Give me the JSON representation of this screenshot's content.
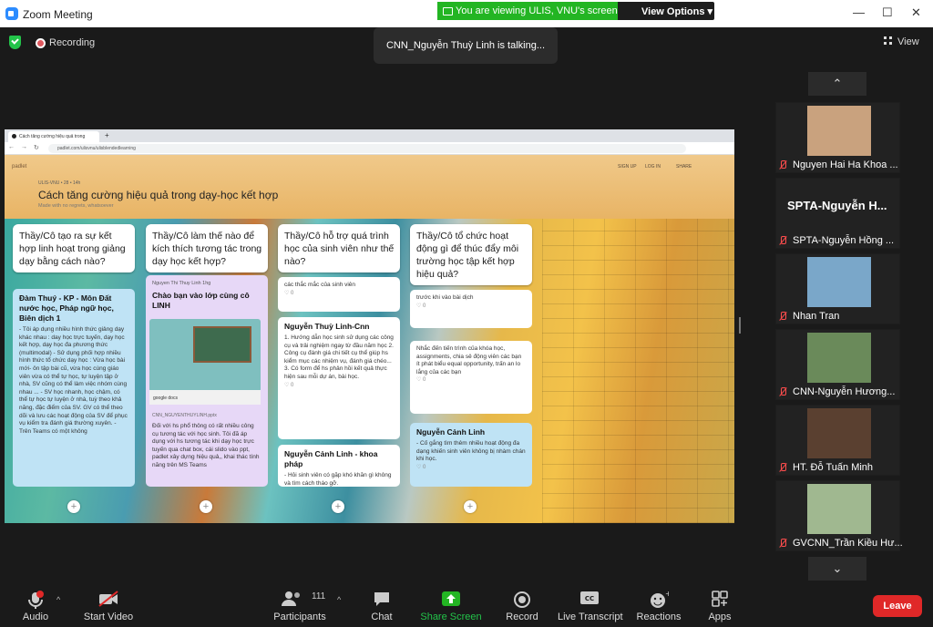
{
  "window": {
    "title": "Zoom Meeting",
    "minimize": "—",
    "maximize": "☐",
    "close": "✕"
  },
  "banner": {
    "text": "You are viewing ULIS, VNU's screen",
    "view_options": "View Options"
  },
  "recording": "Recording",
  "talking": "CNN_Nguyễn Thuỳ Linh is talking...",
  "view": "View",
  "browser": {
    "tab_title": "Cách tăng cường hiệu quả trong",
    "url": "padlet.com/ulisvnu/ulisblendedlearning"
  },
  "padlet": {
    "logo": "padlet",
    "signup": "SIGN UP",
    "login": "LOG IN",
    "share": "SHARE",
    "meta": "ULIS-VNU  •  28  •  14h",
    "title": "Cách tăng cường hiệu quả trong dạy-học kết hợp",
    "subtitle": "Made with no regrets, whatsoever",
    "columns": [
      {
        "header": "Thầy/Cô tạo ra sự kết hợp linh hoạt trong giảng dạy bằng cách nào?",
        "cards": [
          {
            "title": "Đàm Thuý - KP - Môn Đất nước học, Pháp ngữ học, Biên dịch 1",
            "body": "-     Tôi áp dụng nhiều hình thức giảng dạy khác nhau : day học trực tuyến, dạy học kết hợp, dạy học đa phương thức (multimodal) -     Sử dụng phối hợp nhiều hình thức tổ chức dạy học : Vừa học bài mới- ôn tập bài cũ, vừa học cùng giáo viên vừa có thể tự học, tự luyện tập ở nhà, SV cũng có thể làm việc nhóm cùng nhau ... -     SV học nhanh, học chậm, có thể tự học tự luyện ở nhà, tuỳ theo khả năng, đặc điểm của SV. GV có thể theo dõi và lưu các hoạt động của SV để phục vụ kiểm tra đánh giá thường xuyên. -     Trên Teams có một không"
          }
        ]
      },
      {
        "header": "Thầy/Cô làm thế nào để kích thích tương tác trong dạy học kết hợp?",
        "cards": [
          {
            "author": "Nguyen Thi Thuy Linh",
            "time": "1hg",
            "title": "Chào bạn vào lớp cùng cô LINH",
            "gdocs": "google docs",
            "file": "CNN_NGUYENTHUYLINH.pptx",
            "body": "Đối với hs phổ thông có rất nhiều công cụ tương tác với học sinh. Tôi đã áp dụng với hs tương tác khi dạy học trực tuyến qua chat box, cái slido vào ppt, padlet xây dựng hiệu quả,, khai thác tính năng trên MS Teams"
          }
        ]
      },
      {
        "header": "Thầy/Cô hỗ trợ quá trình học của sinh viên như thế nào?",
        "cards": [
          {
            "body": "các thắc mắc của sinh viên",
            "likes": "0"
          },
          {
            "title": "Nguyễn Thuỳ Linh-Cnn",
            "body": "1. Hướng dẫn học sinh sử dụng các công cụ và trải nghiệm ngay từ đầu năm học 2. Công cụ đánh giá chi tiết cụ thể giúp hs kiểm mục các nhiệm vụ, đánh giá chéo... 3. Có form để hs phản hồi kết quả thực hiện sau mỗi dự án, bài học.",
            "likes": "0"
          },
          {
            "title": "Nguyễn Cảnh Linh - khoa pháp",
            "body": "- Hỏi sinh viên có gặp khó khăn gì không và tìm cách tháo gỡ."
          }
        ]
      },
      {
        "header": "Thầy/Cô tổ chức hoạt động gì để thúc đẩy môi trường học tập kết hợp hiệu quả?",
        "cards": [
          {
            "body": "trước khi vào bài dịch",
            "likes": "0"
          },
          {
            "body": "Nhắc đến tiến trình của khóa học, assignments, chia sẻ động viên các bạn ít phát biểu equal opportunity, trấn an lo lắng của các bạn",
            "likes": "0"
          },
          {
            "title": "Nguyễn Cảnh Linh",
            "body": "- Cố gắng tìm thêm nhiều hoạt động đa dạng khiến sinh viên không bị nhàm chán khi học.",
            "likes": "0"
          }
        ]
      }
    ]
  },
  "participants": [
    {
      "name": "Nguyen Hai Ha Khoa ...",
      "photo_color": "#c9a27e"
    },
    {
      "name": "SPTA-Nguyễn Hồng ...",
      "big": "SPTA-Nguyễn  H..."
    },
    {
      "name": "Nhan Tran",
      "photo_color": "#7aa7c9"
    },
    {
      "name": "CNN-Nguyễn Hương...",
      "photo_color": "#6a8a5a"
    },
    {
      "name": "HT. Đỗ Tuấn Minh",
      "photo_color": "#5a4030"
    },
    {
      "name": "GVCNN_Trần Kiều Hư...",
      "photo_color": "#a0b890"
    }
  ],
  "toolbar": {
    "audio": "Audio",
    "video": "Start Video",
    "participants": "Participants",
    "participant_count": "111",
    "chat": "Chat",
    "share": "Share Screen",
    "record": "Record",
    "transcript": "Live Transcript",
    "reactions": "Reactions",
    "apps": "Apps",
    "leave": "Leave"
  },
  "colors": {
    "share_green": "#23b523",
    "leave_red": "#e02828",
    "card_blue": "#bfe3f5",
    "card_purple": "#e7d8f7"
  }
}
